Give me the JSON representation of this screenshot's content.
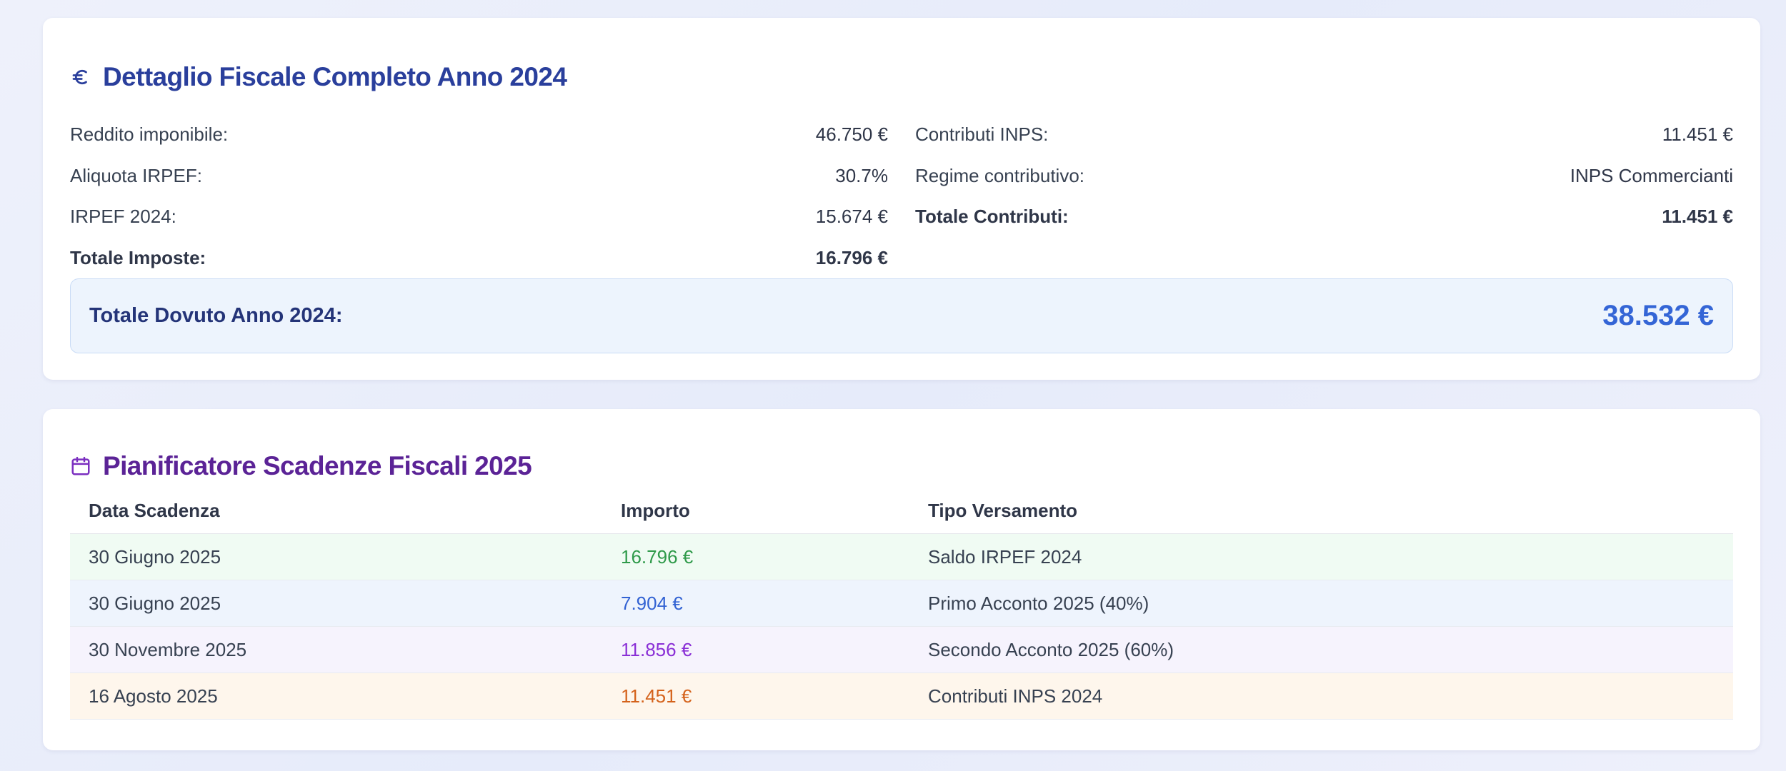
{
  "fiscal": {
    "title": "Dettaglio Fiscale Completo Anno 2024",
    "icon": "euro-icon",
    "left": [
      {
        "label": "Reddito imponibile:",
        "value": "46.750 €",
        "bold": false
      },
      {
        "label": "Aliquota IRPEF:",
        "value": "30.7%",
        "bold": false
      },
      {
        "label": "IRPEF 2024:",
        "value": "15.674 €",
        "bold": false
      },
      {
        "label": "Totale Imposte:",
        "value": "16.796 €",
        "bold": true
      }
    ],
    "right": [
      {
        "label": "Contributi INPS:",
        "value": "11.451 €",
        "bold": false
      },
      {
        "label": "Regime contributivo:",
        "value": "INPS Commercianti",
        "bold": false
      },
      {
        "label": "Totale Contributi:",
        "value": "11.451 €",
        "bold": true
      }
    ],
    "total": {
      "label": "Totale Dovuto Anno 2024:",
      "value": "38.532 €"
    }
  },
  "planner": {
    "title": "Pianificatore Scadenze Fiscali 2025",
    "icon": "calendar-icon",
    "headers": {
      "date": "Data Scadenza",
      "amount": "Importo",
      "type": "Tipo Versamento"
    },
    "rows": [
      {
        "date": "30 Giugno 2025",
        "amount": "16.796 €",
        "type": "Saldo IRPEF 2024",
        "color": "#2f9a4a"
      },
      {
        "date": "30 Giugno 2025",
        "amount": "7.904 €",
        "type": "Primo Acconto 2025 (40%)",
        "color": "#3262d3"
      },
      {
        "date": "30 Novembre 2025",
        "amount": "11.856 €",
        "type": "Secondo Acconto 2025 (60%)",
        "color": "#8a2fd6"
      },
      {
        "date": "16 Agosto 2025",
        "amount": "11.451 €",
        "type": "Contributi INPS 2024",
        "color": "#d4621b"
      }
    ]
  }
}
